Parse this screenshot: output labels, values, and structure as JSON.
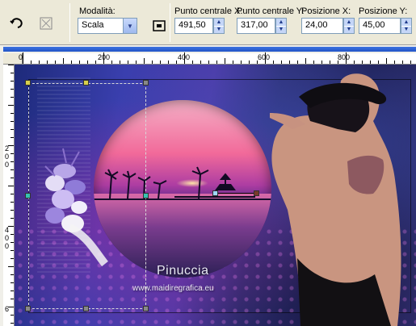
{
  "toolbar": {
    "mode_label": "Modalità:",
    "mode_value": "Scala",
    "center_x_label": "Punto centrale X:",
    "center_x_value": "491,50",
    "center_y_label": "Punto centrale Y:",
    "center_y_value": "317,00",
    "pos_x_label": "Posizione X:",
    "pos_x_value": "24,00",
    "pos_y_label": "Posizione Y:",
    "pos_y_value": "45,00"
  },
  "ruler_top": [
    "0",
    "200",
    "400",
    "600",
    "800"
  ],
  "ruler_left": [
    "2",
    "0",
    "0",
    "4",
    "0",
    "0",
    "6"
  ],
  "canvas": {
    "watermark_name": "Pinuccia",
    "watermark_url": "www.maidiregrafica.eu"
  },
  "colors": {
    "toolbar_bg": "#ece9d8",
    "field_border": "#7f9db9",
    "spin_bg": "#c5d6f7"
  },
  "icons": [
    "undo-icon",
    "reset-icon",
    "center-pivot-icon",
    "chevron-down-icon",
    "spin-up-icon",
    "spin-down-icon",
    "close-icon"
  ]
}
